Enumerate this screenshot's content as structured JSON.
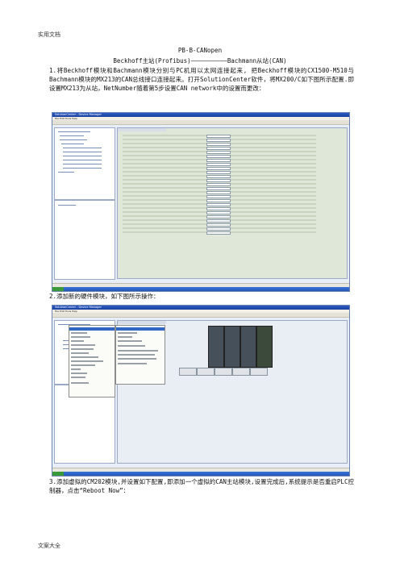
{
  "page": {
    "header": "实用文档",
    "footer": "文案大全",
    "title": "PB-B-CANopen",
    "subtitle": "Beckhoff主站(Profibus)——————————Bachmann从站(CAN)",
    "paragraph1": "1.将Beckhoff模块和Bachmann模块分别与PC机用以太网连接起来, 把Beckhoff模块的CX1500-M510与Bachmann模块的MX213的CAN总线接口连接起来。打开SolutionCenter软件，将MX200/C如下图所示配置.即设置MX213为从站，NetNumber随着第5步设置CAN network中的设置而更改：",
    "paragraph2": "2.添加新的硬件模块，如下图所示操作：",
    "paragraph3": "3.添加虚拟的CM202模块,并设置如下配置,即添加一个虚拟的CAN主站模块,设置完成后,系统提示是否重启PLC控制器，点击“Reboot Now”："
  },
  "screenshot1": {
    "window_title": "SolutionCenter - Device Manager",
    "menu": "File  Edit  Tools  Help",
    "tab_label": "Module Configuration"
  },
  "screenshot2": {
    "window_title": "SolutionCenter - Device Manager",
    "menu": "File  Edit  Tools  Help",
    "tab_label": "Configuration"
  }
}
